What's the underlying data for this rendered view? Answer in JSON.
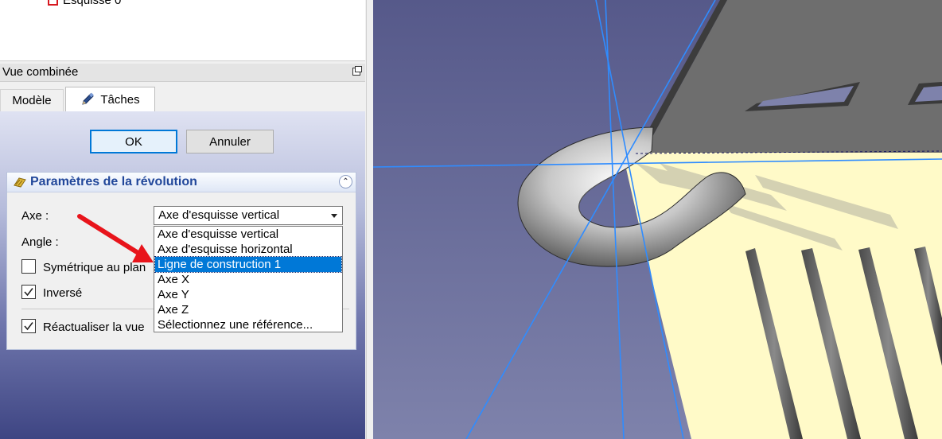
{
  "tree": {
    "partial_item_label": "Esquisse 0"
  },
  "dock": {
    "title": "Vue combinée"
  },
  "tabs": [
    {
      "label": "Modèle"
    },
    {
      "label": "Tâches"
    }
  ],
  "buttons": {
    "ok": "OK",
    "cancel": "Annuler"
  },
  "panel": {
    "title": "Paramètres de la révolution",
    "axis_label": "Axe :",
    "axis_value": "Axe d'esquisse vertical",
    "angle_label": "Angle :",
    "symmetric_label": "Symétrique au plan",
    "symmetric_checked": false,
    "reversed_label": "Inversé",
    "reversed_checked": true,
    "refresh_label": "Réactualiser la vue",
    "refresh_checked": true
  },
  "dropdown": {
    "options": [
      "Axe d'esquisse vertical",
      "Axe d'esquisse horizontal",
      "Ligne de construction 1",
      "Axe X",
      "Axe Y",
      "Axe Z",
      "Sélectionnez une référence..."
    ],
    "highlighted": "Ligne de construction 1"
  },
  "colors": {
    "viewport_bg_top": "#5a5c8a",
    "viewport_bg_bottom": "#7d80a8",
    "highlight": "#0078d7",
    "annotation_arrow": "#e8141b",
    "sketch_plane": "#fffac8",
    "axis_line": "#2f8cff"
  }
}
